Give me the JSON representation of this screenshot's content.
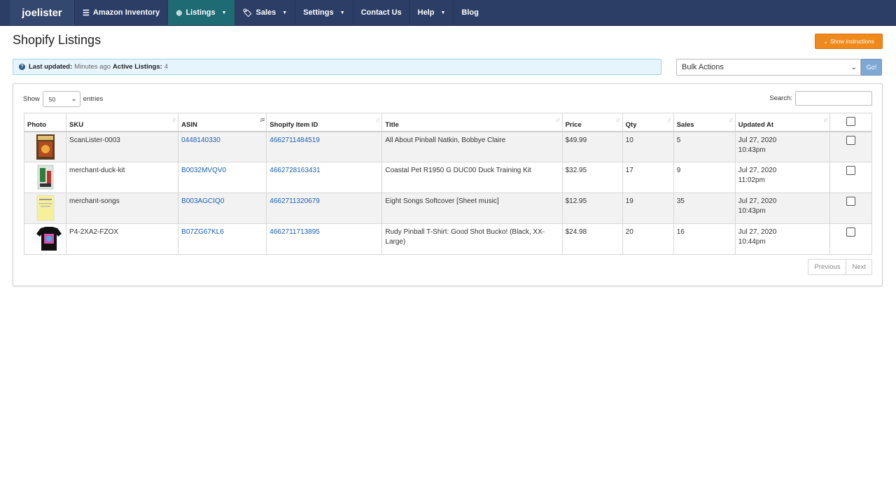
{
  "nav": {
    "brand": "joelister",
    "items": [
      {
        "label": "Amazon Inventory",
        "icon": "list-icon",
        "glyph": "☰",
        "caret": false,
        "active": false
      },
      {
        "label": "Listings",
        "icon": "upload-circle-icon",
        "glyph": "⊕",
        "caret": true,
        "active": true
      },
      {
        "label": "Sales",
        "icon": "tags-icon",
        "glyph": "🏷",
        "caret": true,
        "active": false
      },
      {
        "label": "Settings",
        "icon": "",
        "glyph": "",
        "caret": true,
        "active": false
      },
      {
        "label": "Contact Us",
        "icon": "",
        "glyph": "",
        "caret": false,
        "active": false
      },
      {
        "label": "Help",
        "icon": "",
        "glyph": "",
        "caret": true,
        "active": false
      },
      {
        "label": "Blog",
        "icon": "",
        "glyph": "",
        "caret": false,
        "active": false
      }
    ]
  },
  "header": {
    "title": "Shopify Listings",
    "instructions_label": "Show instructions"
  },
  "info": {
    "last_updated_label": "Last updated:",
    "last_updated_value": "Minutes ago",
    "active_label": "Active Listings:",
    "active_value": "4"
  },
  "bulk": {
    "selected": "Bulk Actions",
    "go_label": "Go!"
  },
  "table_controls": {
    "show_label": "Show",
    "length_value": "50",
    "entries_label": "entries",
    "search_label": "Search:"
  },
  "columns": [
    "Photo",
    "SKU",
    "ASIN",
    "Shopify Item ID",
    "Title",
    "Price",
    "Qty",
    "Sales",
    "Updated At"
  ],
  "rows": [
    {
      "sku": "ScanLister-0003",
      "asin": "0448140330",
      "shopify_id": "4662711484519",
      "title": "All About Pinball Natkin, Bobbye Claire",
      "price": "$49.99",
      "qty": "10",
      "sales": "5",
      "date": "Jul 27, 2020",
      "time": "10:43pm"
    },
    {
      "sku": "merchant-duck-kit",
      "asin": "B0032MVQV0",
      "shopify_id": "4662728163431",
      "title": "Coastal Pet R1950 G DUC00 Duck Training Kit",
      "price": "$32.95",
      "qty": "17",
      "sales": "9",
      "date": "Jul 27, 2020",
      "time": "11:02pm"
    },
    {
      "sku": "merchant-songs",
      "asin": "B003AGCIQ0",
      "shopify_id": "4662711320679",
      "title": "Eight Songs Softcover [Sheet music]",
      "price": "$12.95",
      "qty": "19",
      "sales": "35",
      "date": "Jul 27, 2020",
      "time": "10:43pm"
    },
    {
      "sku": "P4-2XA2-FZOX",
      "asin": "B07ZG67KL6",
      "shopify_id": "4662711713895",
      "title": "Rudy Pinball T-Shirt: Good Shot Bucko! (Black, XX-Large)",
      "price": "$24.98",
      "qty": "20",
      "sales": "16",
      "date": "Jul 27, 2020",
      "time": "10:44pm"
    }
  ],
  "pager": {
    "previous": "Previous",
    "next": "Next"
  }
}
